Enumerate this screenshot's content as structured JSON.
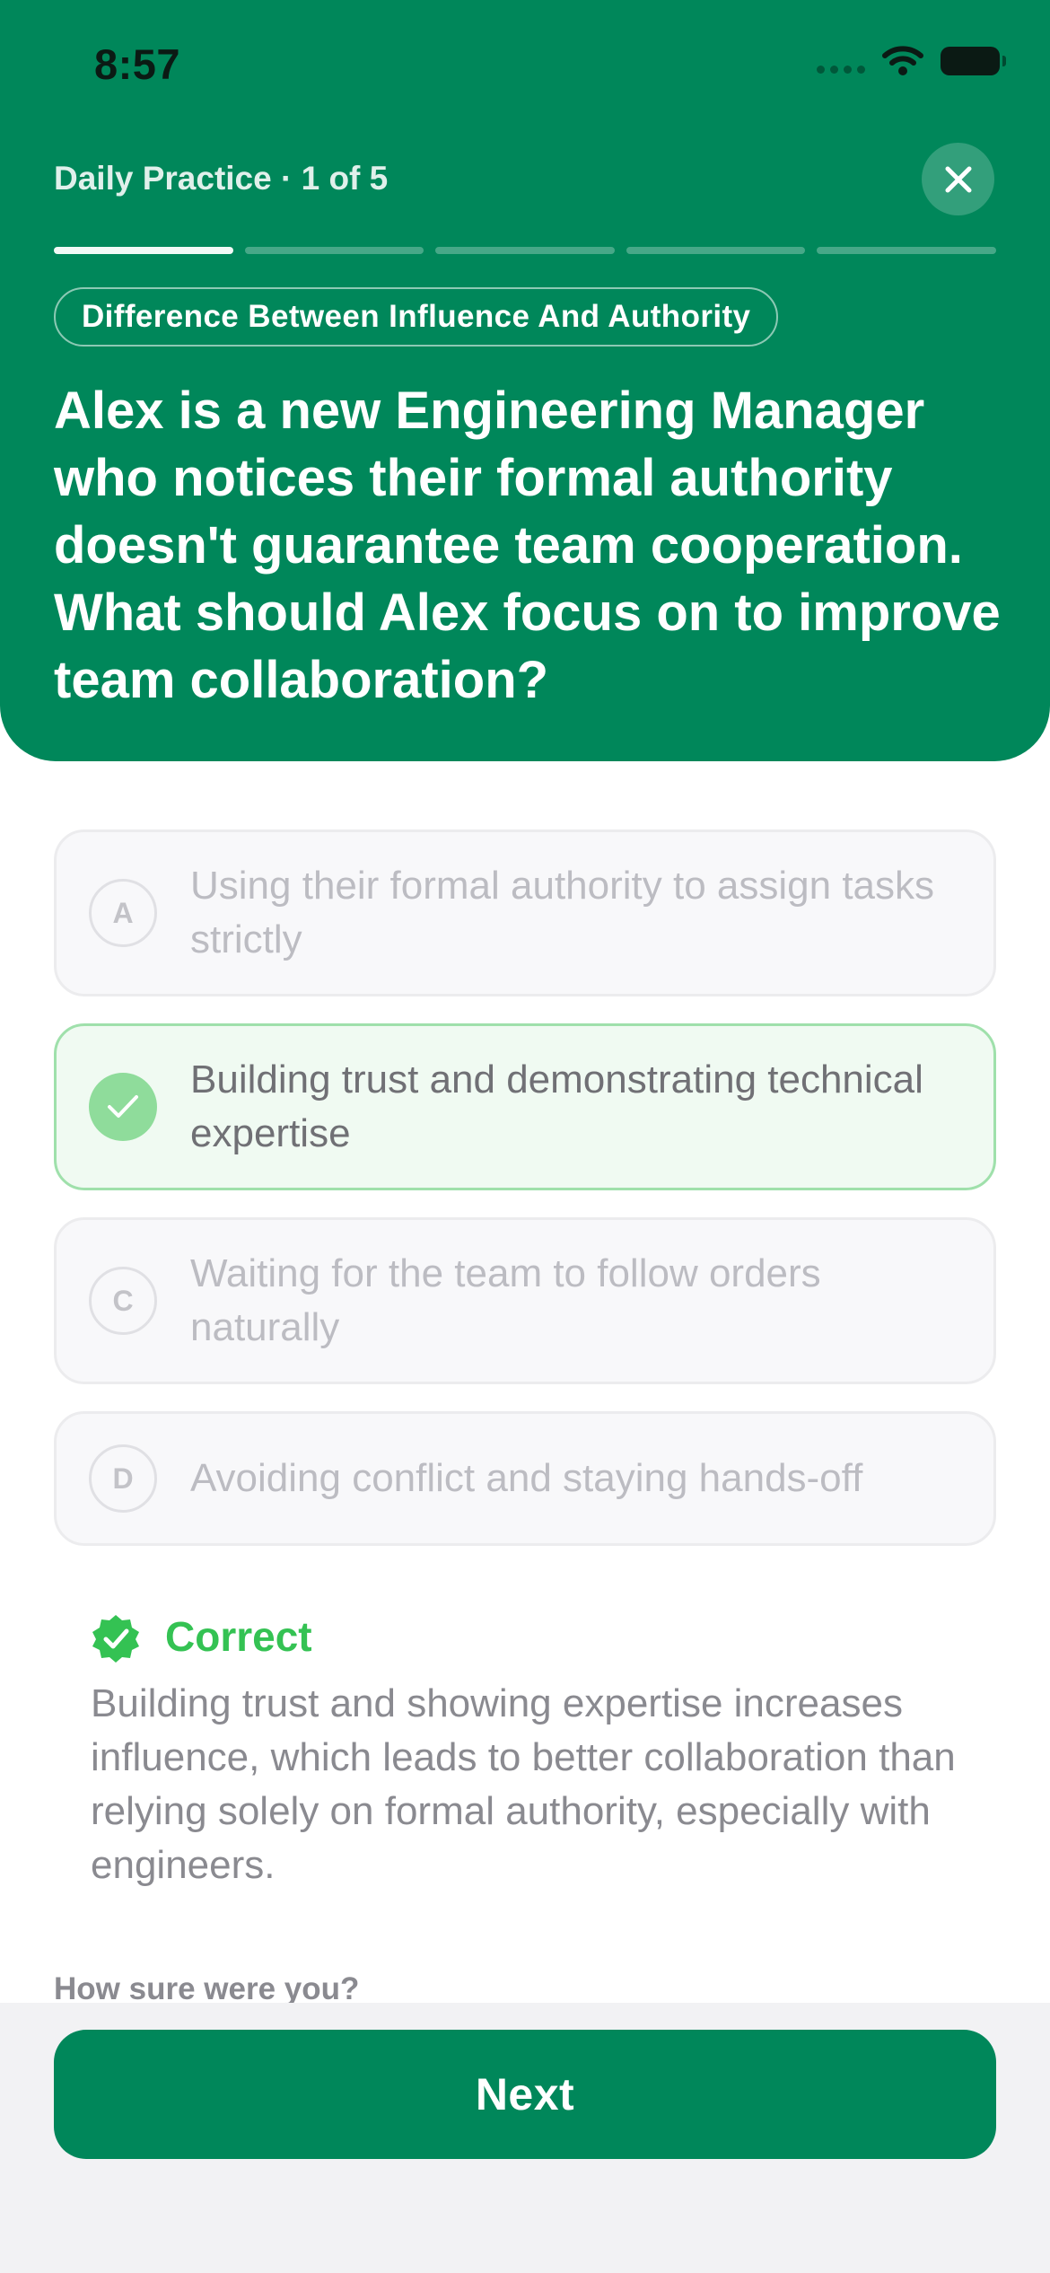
{
  "status_bar": {
    "time": "8:57",
    "icons": [
      "signal-icon",
      "wifi-icon",
      "battery-icon"
    ]
  },
  "header": {
    "practice_label": "Daily Practice · 1 of 5",
    "close_icon": "close-icon",
    "progress": {
      "current": 1,
      "total": 5
    },
    "topic": "Difference Between Influence And Authority",
    "question": "Alex is a new Engineering Manager who notices their formal authority doesn't guarantee team cooperation. What should Alex focus on to improve team collaboration?"
  },
  "options": [
    {
      "letter": "A",
      "text": "Using their formal authority to assign tasks strictly",
      "selected": false
    },
    {
      "letter": "B",
      "text": "Building trust and demonstrating technical expertise",
      "selected": true,
      "icon": "check-icon"
    },
    {
      "letter": "C",
      "text": "Waiting for the team to follow orders naturally",
      "selected": false
    },
    {
      "letter": "D",
      "text": "Avoiding conflict and staying hands-off",
      "selected": false
    }
  ],
  "feedback": {
    "icon": "verified-badge-icon",
    "title": "Correct",
    "body": "Building trust and showing expertise increases influence, which leads to better collaboration than relying solely on formal authority, especially with engineers."
  },
  "confidence_label": "How sure were you?",
  "next_label": "Next",
  "colors": {
    "brand": "#00875a",
    "correct": "#34c253",
    "selected_border": "#9fe0ab",
    "selected_bg": "#f0faf2"
  }
}
